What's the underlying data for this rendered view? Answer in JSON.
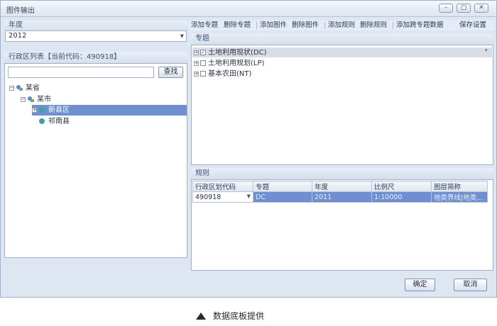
{
  "window": {
    "title": "图件输出",
    "controls": [
      "minimize-icon",
      "maximize-icon",
      "close-icon"
    ]
  },
  "year_section": {
    "label": "年度",
    "value": "2012"
  },
  "region_section": {
    "label": "行政区列表【当前代码：490918】",
    "search_placeholder": "",
    "search_button": "查找",
    "tree": [
      {
        "label": "某省",
        "level": 0
      },
      {
        "label": "某市",
        "level": 1
      },
      {
        "label": "新县区",
        "level": 2,
        "selected": true
      },
      {
        "label": "祁南县",
        "level": 2
      }
    ]
  },
  "toolbar": {
    "items": [
      "添加专题",
      "删除专题",
      "添加图件",
      "删除图件",
      "添加规则",
      "删除规则",
      "添加跨专题数据",
      "保存设置"
    ]
  },
  "topic_section": {
    "label": "专题",
    "items": [
      {
        "label": "土地利用现状(DC)",
        "checked": true,
        "selected": true
      },
      {
        "label": "土地利用规划(LP)",
        "checked": false
      },
      {
        "label": "基本农田(NT)",
        "checked": false
      }
    ]
  },
  "rules_section": {
    "label": "规则",
    "columns": [
      "行政区划代码",
      "专题",
      "年度",
      "比例尺",
      "图层简称"
    ],
    "rows": [
      [
        "490918",
        "DC",
        "2011",
        "1:10000",
        "地类界线|地类..."
      ]
    ]
  },
  "footer": {
    "ok": "确定",
    "cancel": "取消"
  },
  "caption": "数据底板提供",
  "colors": {
    "selection": "#6f8fd0",
    "header_text": "#3b5378",
    "window_bg": "#dde6f1"
  }
}
